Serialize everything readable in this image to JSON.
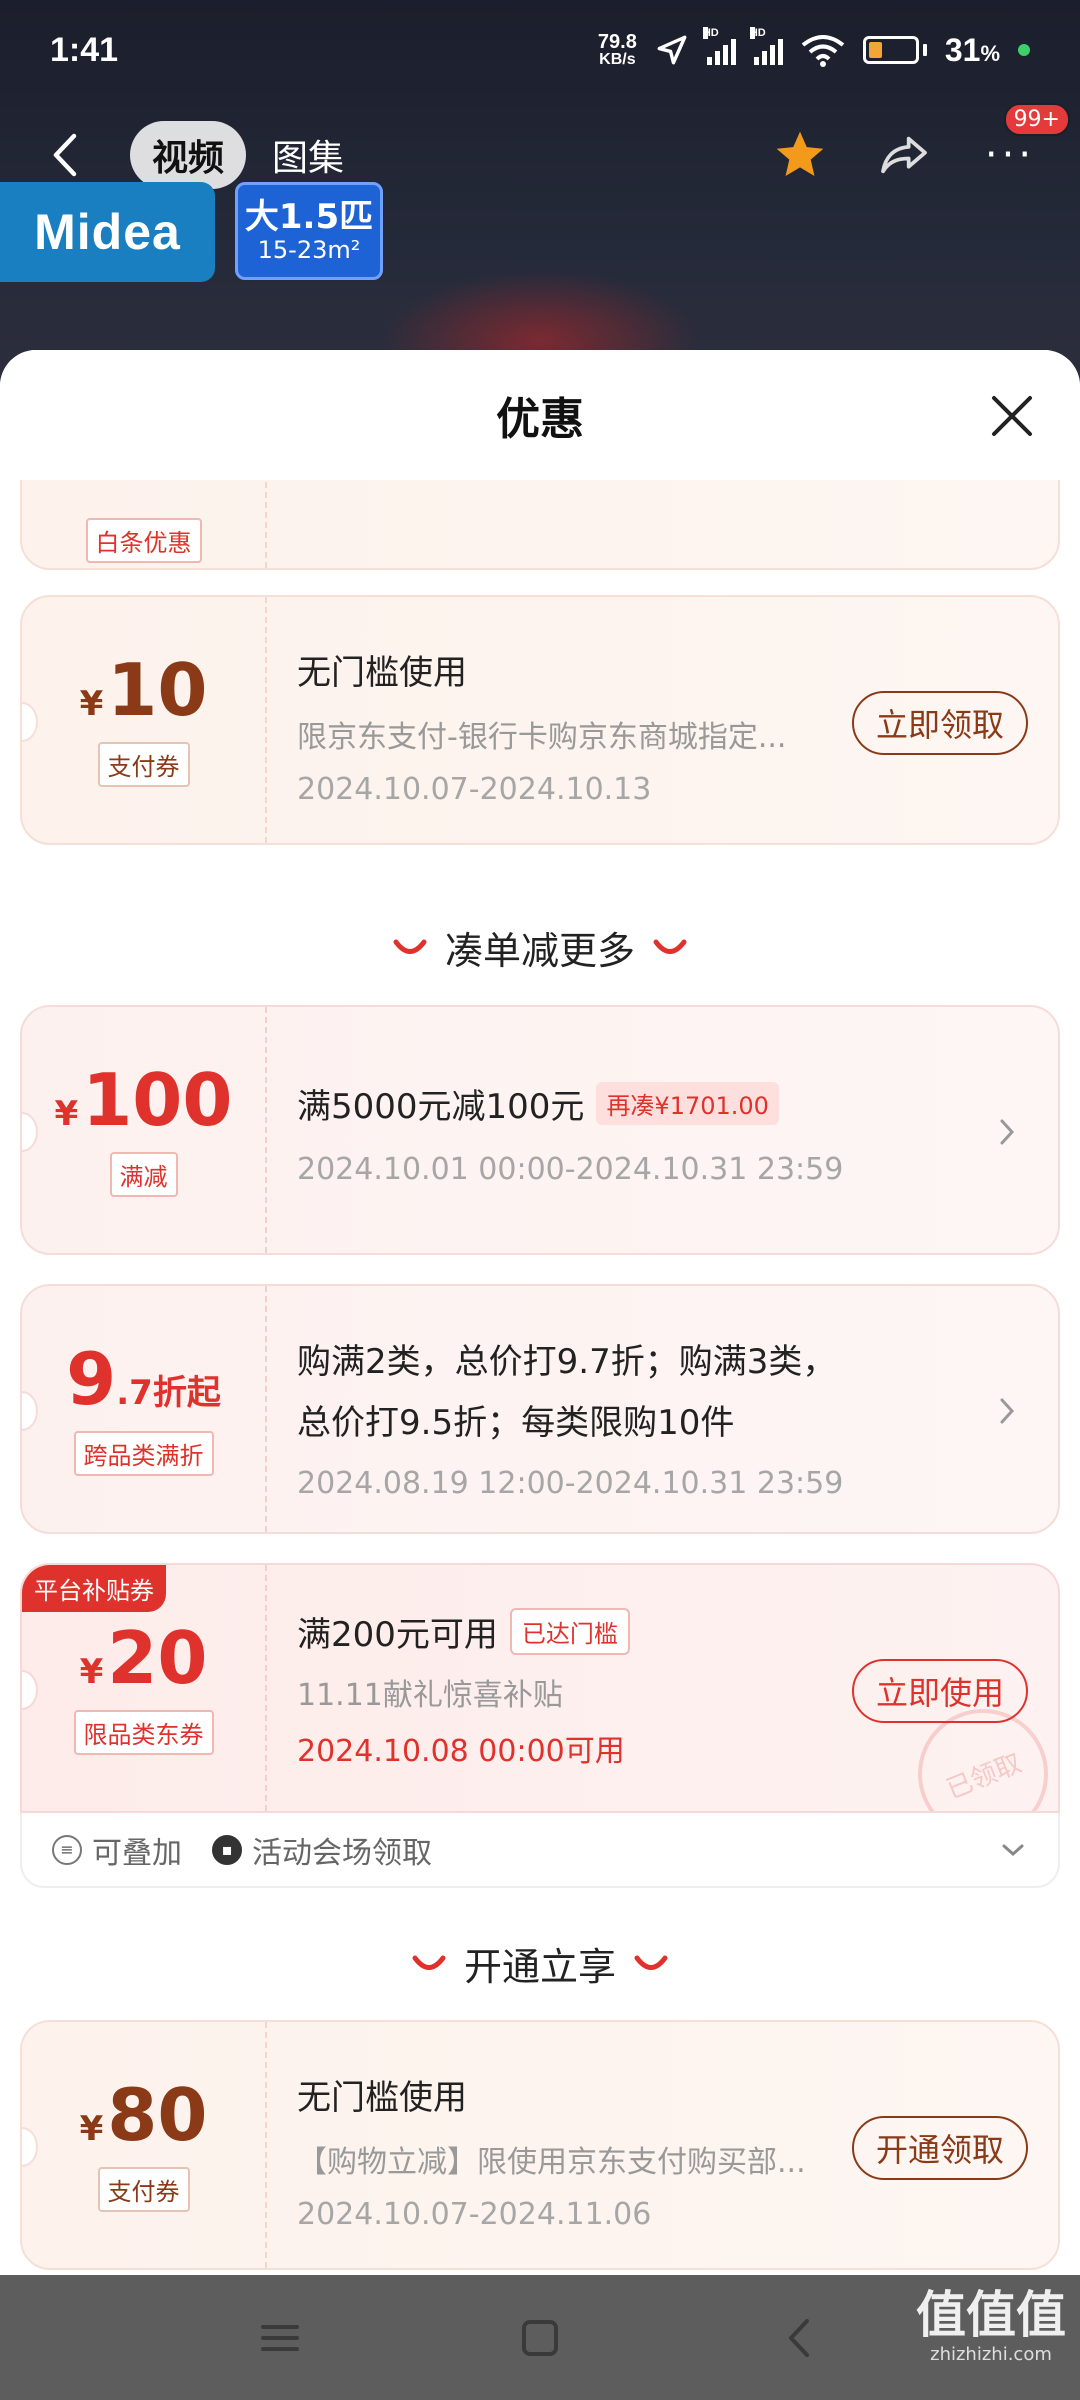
{
  "status_bar": {
    "time": "1:41",
    "net_speed_value": "79.8",
    "net_speed_unit": "KB/s",
    "signal_tag": "HD",
    "battery_percent": "31",
    "battery_suffix": "%"
  },
  "top_nav": {
    "tab_video": "视频",
    "tab_gallery": "图集",
    "badge_count": "99+"
  },
  "brand": {
    "logo_text": "Midea",
    "spec_line1": "大1.5匹",
    "spec_line2": "15-23m²"
  },
  "sheet": {
    "title": "优惠",
    "partial_card": {
      "tag": "白条优惠"
    },
    "card1": {
      "currency": "¥",
      "amount": "10",
      "tag": "支付券",
      "title": "无门槛使用",
      "desc": "限京东支付-银行卡购京东商城指定...",
      "date": "2024.10.07-2024.10.13",
      "button": "立即领取"
    },
    "section1": "凑单减更多",
    "card2": {
      "currency": "¥",
      "amount": "100",
      "tag": "满减",
      "title": "满5000元减100元",
      "pill": "再凑¥1701.00",
      "date": "2024.10.01 00:00-2024.10.31 23:59"
    },
    "card3": {
      "amount_big": "9",
      "amount_small": ".7折起",
      "tag": "跨品类满折",
      "line1": "购满2类，总价打9.7折；购满3类，",
      "line2": "总价打9.5折；每类限购10件",
      "date": "2024.08.19 12:00-2024.10.31 23:59"
    },
    "card4": {
      "corner": "平台补贴券",
      "currency": "¥",
      "amount": "20",
      "tag": "限品类东券",
      "title": "满200元可用",
      "pill": "已达门槛",
      "desc": "11.11献礼惊喜补贴",
      "date": "2024.10.08 00:00可用",
      "button": "立即使用",
      "stamp": "已领取",
      "footer_a": "可叠加",
      "footer_b": "活动会场领取"
    },
    "section2": "开通立享",
    "card5": {
      "currency": "¥",
      "amount": "80",
      "tag": "支付券",
      "title": "无门槛使用",
      "desc": "【购物立减】限使用京东支付购买部...",
      "date": "2024.10.07-2024.11.06",
      "button": "开通领取"
    }
  },
  "watermark": {
    "logo": "值值值",
    "site": "zhizhizhi.com"
  },
  "colors": {
    "accent_red": "#e0322c",
    "brown": "#8a3a17",
    "star": "#f39a1b"
  }
}
